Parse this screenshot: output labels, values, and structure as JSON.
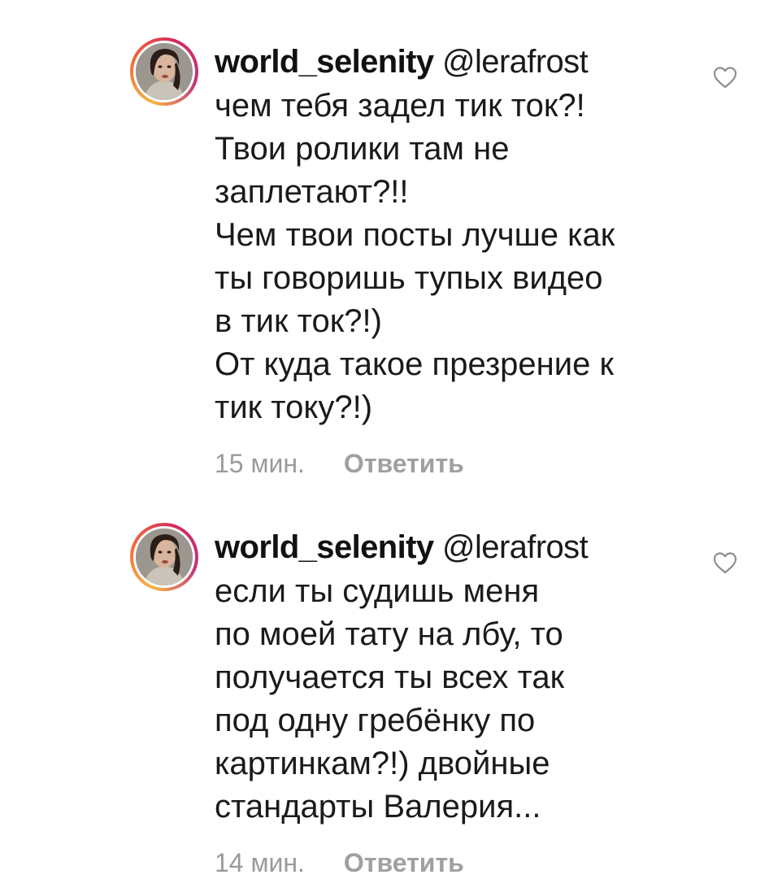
{
  "comments": [
    {
      "username": "world_selenity",
      "mention": "@lerafrost",
      "lines": [
        "чем тебя задел тик ток?!",
        "Твои ролики там не",
        "заплетают?!!",
        "Чем твои посты лучше как",
        "ты говоришь тупых видео",
        "в тик ток?!)",
        "От куда такое презрение к",
        "тик току?!)"
      ],
      "time": "15 мин.",
      "reply_label": "Ответить",
      "avatar_icon": "user-avatar",
      "like_icon": "heart-outline-icon"
    },
    {
      "username": "world_selenity",
      "mention": "@lerafrost",
      "lines": [
        "если ты судишь меня",
        "по моей тату на лбу, то",
        "получается ты всех так",
        "под одну гребёнку по",
        "картинкам?!) двойные",
        "стандарты Валерия..."
      ],
      "time": "14 мин.",
      "reply_label": "Ответить",
      "avatar_icon": "user-avatar",
      "like_icon": "heart-outline-icon"
    }
  ],
  "colors": {
    "text": "#1a1a1a",
    "meta": "#9a9a9a",
    "story_ring_start": "#f7b548",
    "story_ring_end": "#c1357d"
  }
}
